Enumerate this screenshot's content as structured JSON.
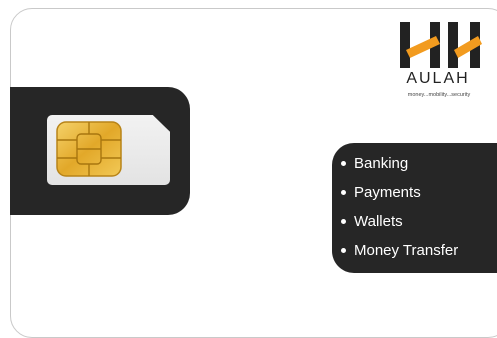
{
  "brand": {
    "name": "AULAH",
    "tagline": "money...mobility...security"
  },
  "features": [
    "Banking",
    "Payments",
    "Wallets",
    "Money Transfer"
  ],
  "colors": {
    "panel": "#262626",
    "logo_orange": "#f29b1f",
    "logo_dark": "#222222",
    "chip_gold": "#e9b43b"
  },
  "icons": {
    "sim": "sim-card-icon",
    "chip": "chip-icon",
    "logo": "logo-icon"
  }
}
